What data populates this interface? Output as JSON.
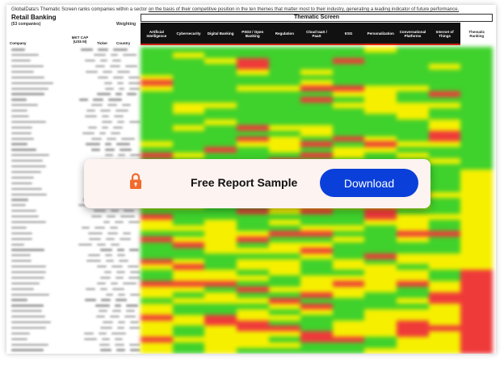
{
  "header": {
    "intro_lead": "GlobalData's Thematic Screen ranks companies within a sector ",
    "intro_link": "on the basis of their competitive position in the  ten themes that matter most to their industry, generating a leading indicator of future performance.",
    "title": "Retail Banking",
    "subtitle": "(53 companies)",
    "weighting": "Weighting",
    "screen_title": "Thematic Screen"
  },
  "left_columns": {
    "company": "Company",
    "mktcap": "MKT CAP (US$ M)",
    "ticker": "Ticker",
    "country": "Country"
  },
  "themes": [
    "Artificial Intelligence",
    "Cybersecurity",
    "Digital Banking",
    "PSD2 / Open Banking",
    "Regulation",
    "Cloud IaaS / PaaS",
    "ESG",
    "Personalization",
    "Conversational Platforms",
    "Internet of Things",
    "Thematic Ranking"
  ],
  "colors": {
    "green": "#3fd12c",
    "yellow": "#f6f000",
    "red": "#ef3a3a",
    "button_blue": "#0a3fd9",
    "lock_orange": "#f26b2c"
  },
  "overlay": {
    "icon": "lock-icon",
    "title": "Free Report Sample",
    "button_label": "Download"
  }
}
